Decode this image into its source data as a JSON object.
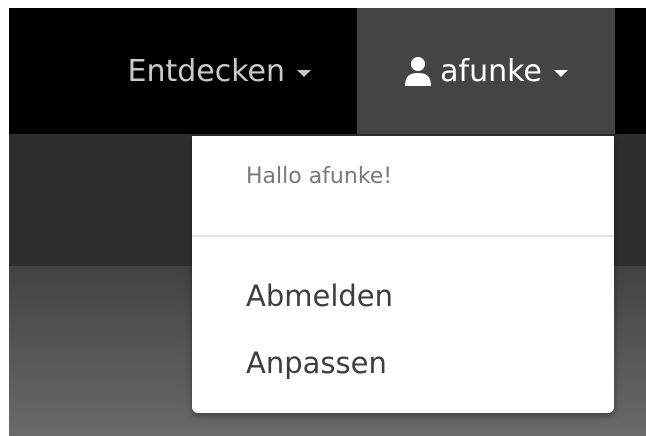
{
  "navbar": {
    "explore_label": "Entdecken",
    "user_label": "afunke"
  },
  "user_menu": {
    "greeting": "Hallo afunke!",
    "items": [
      {
        "label": "Abmelden"
      },
      {
        "label": "Anpassen"
      }
    ]
  },
  "colors": {
    "navbar_bg": "#000000",
    "active_nav_bg": "#444444",
    "dropdown_bg": "#ffffff"
  },
  "icons": {
    "user": "user-icon",
    "caret": "caret-down-icon"
  }
}
